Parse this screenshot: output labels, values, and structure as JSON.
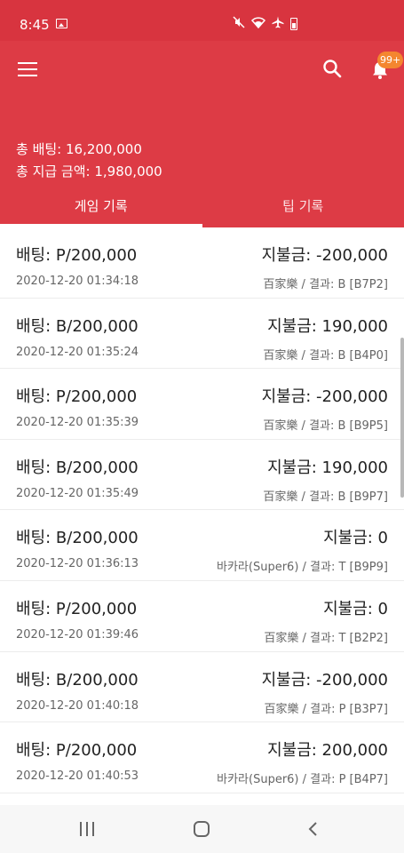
{
  "status_bar": {
    "time": "8:45",
    "icons": [
      "gallery-icon",
      "mute-icon",
      "wifi-icon",
      "airplane-icon",
      "battery-icon"
    ]
  },
  "app_bar": {
    "color": "#dd3b45",
    "status_color": "#d8343f",
    "notification_badge": "99+",
    "badge_color": "#f4862f",
    "icons": [
      "menu-icon",
      "search-icon",
      "bell-icon"
    ]
  },
  "summary": {
    "total_bet": "총 배팅: 16,200,000",
    "total_payout": "총 지급 금액: 1,980,000"
  },
  "tabs": [
    {
      "label": "게임 기록",
      "active": true
    },
    {
      "label": "팁 기록",
      "active": false
    }
  ],
  "records": [
    {
      "bet": "배팅: P/200,000",
      "payout": "지불금: -200,000",
      "time": "2020-12-20 01:34:18",
      "detail": "百家樂 / 결과: B [B7P2]"
    },
    {
      "bet": "배팅: B/200,000",
      "payout": "지불금: 190,000",
      "time": "2020-12-20 01:35:24",
      "detail": "百家樂 / 결과: B [B4P0]"
    },
    {
      "bet": "배팅: P/200,000",
      "payout": "지불금: -200,000",
      "time": "2020-12-20 01:35:39",
      "detail": "百家樂 / 결과: B [B9P5]"
    },
    {
      "bet": "배팅: B/200,000",
      "payout": "지불금: 190,000",
      "time": "2020-12-20 01:35:49",
      "detail": "百家樂 / 결과: B [B9P7]"
    },
    {
      "bet": "배팅: B/200,000",
      "payout": "지불금: 0",
      "time": "2020-12-20 01:36:13",
      "detail": "바카라(Super6) / 결과: T [B9P9]"
    },
    {
      "bet": "배팅: P/200,000",
      "payout": "지불금: 0",
      "time": "2020-12-20 01:39:46",
      "detail": "百家樂 / 결과: T [B2P2]"
    },
    {
      "bet": "배팅: B/200,000",
      "payout": "지불금: -200,000",
      "time": "2020-12-20 01:40:18",
      "detail": "百家樂 / 결과: P [B3P7]"
    },
    {
      "bet": "배팅: P/200,000",
      "payout": "지불금: 200,000",
      "time": "2020-12-20 01:40:53",
      "detail": "바카라(Super6) / 결과: P [B4P7]"
    }
  ],
  "nav_bar": {
    "icons": [
      "recents-icon",
      "home-icon",
      "back-icon"
    ]
  }
}
